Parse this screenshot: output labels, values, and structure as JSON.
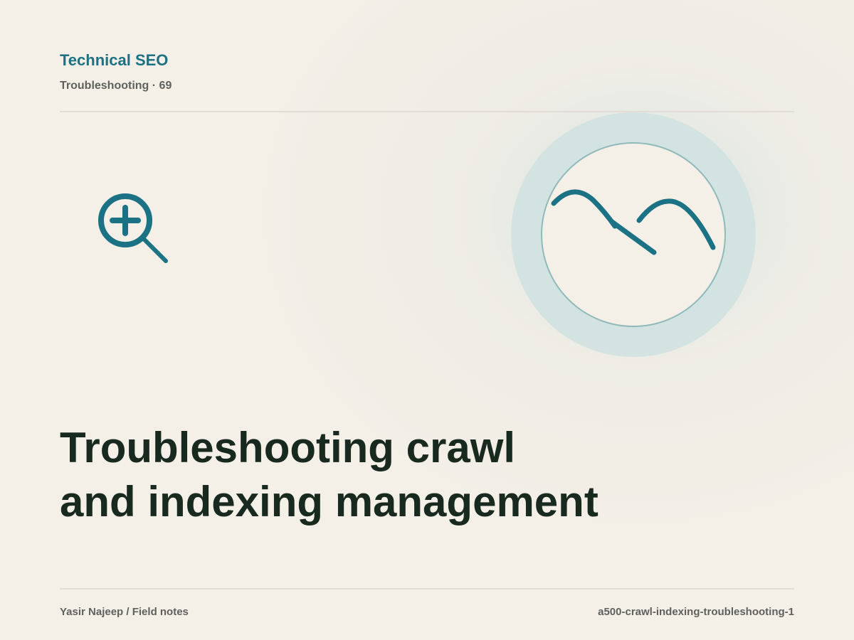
{
  "header": {
    "kicker": "Technical SEO",
    "subline": "Troubleshooting · 69"
  },
  "title": {
    "line1": "Troubleshooting crawl",
    "line2": "and indexing management"
  },
  "footer": {
    "author": "Yasir Najeep / Field notes",
    "slug": "a500-crawl-indexing-troubleshooting-1"
  },
  "icons": {
    "left": "zoom-in-icon",
    "badge": "wave-chart-icon"
  },
  "colors": {
    "accent": "#1b7284",
    "text": "#18291f",
    "muted": "#5f625c",
    "background": "#f4efe7",
    "ring": "#cfe2e0"
  }
}
